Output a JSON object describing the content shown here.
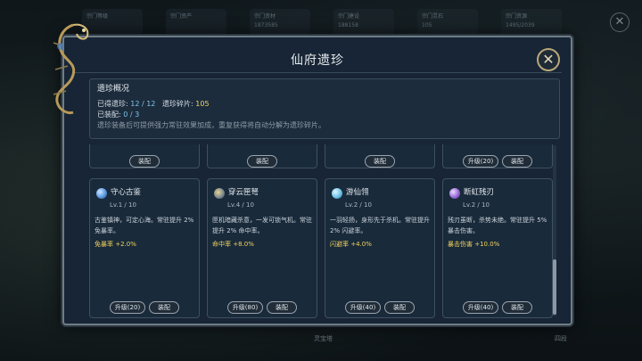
{
  "background": {
    "stats": [
      {
        "label": "宗门等级",
        "value": ""
      },
      {
        "label": "宗门资产",
        "value": ""
      },
      {
        "label": "宗门资材",
        "value": "1873585"
      },
      {
        "label": "宗门建设",
        "value": "188158"
      },
      {
        "label": "宗门灵石",
        "value": "105"
      },
      {
        "label": "宗门资源",
        "value": "1495/2039"
      }
    ],
    "bottom_center": "灵宝塔",
    "bottom_right": "四段"
  },
  "dialog": {
    "title": "仙府遗珍",
    "close_label": "✕"
  },
  "overview": {
    "title": "遗珍概况",
    "collected_label": "已得遗珍:",
    "collected_value": "12 / 12",
    "fragments_label": "遗珍碎片:",
    "fragments_value": "105",
    "equipped_label": "已装配:",
    "equipped_value": "0 / 3",
    "note": "遗珍装备后可提供强力常驻效果加成，重复获得将自动分解为遗珍碎片。"
  },
  "top_row": [
    {
      "equip_label": "装配"
    },
    {
      "equip_label": "装配"
    },
    {
      "equip_label": "装配"
    },
    {
      "upgrade_label": "升级(20)",
      "equip_label": "装配"
    }
  ],
  "items": [
    {
      "name": "守心古鉴",
      "level": "Lv.1 / 10",
      "desc": "古鉴镇神，可定心海。常驻提升 2% 免暴率。",
      "bonus": "免暴率 +2.0%",
      "upgrade_label": "升级(20)",
      "equip_label": "装配",
      "gem_color": "#5a9be0"
    },
    {
      "name": "穿云匣弩",
      "level": "Lv.4 / 10",
      "desc": "匣机暗藏杀意，一发可锁气机。常驻提升 2% 命中率。",
      "bonus": "命中率 +8.0%",
      "upgrade_label": "升级(80)",
      "equip_label": "装配",
      "gem_color": "#9aa7b0"
    },
    {
      "name": "游仙翎",
      "level": "Lv.2 / 10",
      "desc": "一羽轻扬，身形先于杀机。常驻提升 2% 闪避率。",
      "bonus": "闪避率 +4.0%",
      "upgrade_label": "升级(40)",
      "equip_label": "装配",
      "gem_color": "#6fc2e8"
    },
    {
      "name": "断虹残刃",
      "level": "Lv.2 / 10",
      "desc": "残刃虽断，杀势未绝。常驻提升 5% 暴击伤害。",
      "bonus": "暴击伤害 +10.0%",
      "upgrade_label": "升级(40)",
      "equip_label": "装配",
      "gem_color": "#9a6ad8"
    }
  ]
}
